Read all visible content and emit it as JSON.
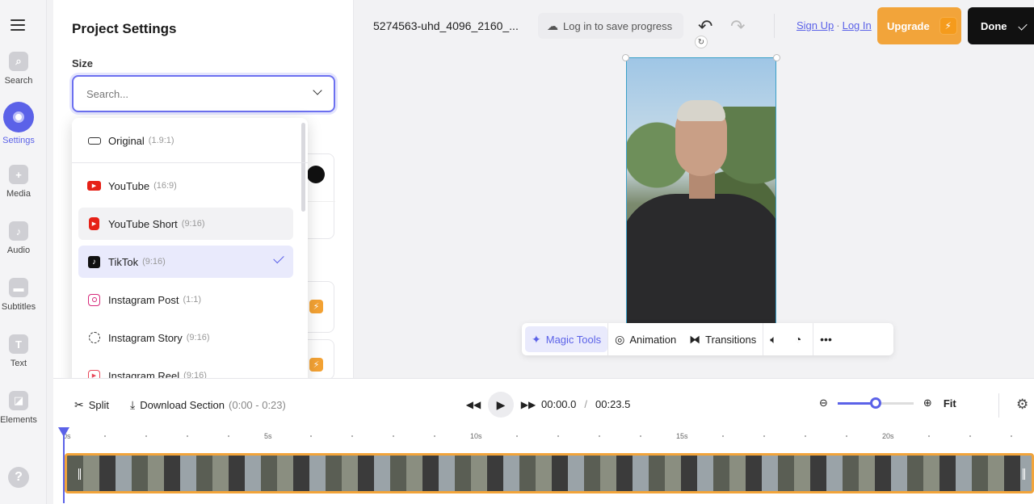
{
  "rail": {
    "items": [
      {
        "label": "Search",
        "icon": "search-icon"
      },
      {
        "label": "Settings",
        "icon": "settings-icon"
      },
      {
        "label": "Media",
        "icon": "plus-icon"
      },
      {
        "label": "Audio",
        "icon": "music-note-icon"
      },
      {
        "label": "Subtitles",
        "icon": "subtitles-icon"
      },
      {
        "label": "Text",
        "icon": "text-icon"
      },
      {
        "label": "Elements",
        "icon": "elements-icon"
      }
    ],
    "help": "?"
  },
  "panel": {
    "title": "Project Settings",
    "size_label": "Size",
    "search_placeholder": "Search..."
  },
  "dropdown": {
    "options": [
      {
        "label": "Original",
        "ratio": "(1.9:1)",
        "icon": "rectangle-icon"
      },
      {
        "label": "YouTube",
        "ratio": "(16:9)",
        "icon": "youtube-icon"
      },
      {
        "label": "YouTube Short",
        "ratio": "(9:16)",
        "icon": "youtube-shorts-icon"
      },
      {
        "label": "TikTok",
        "ratio": "(9:16)",
        "icon": "tiktok-icon",
        "selected": true
      },
      {
        "label": "Instagram Post",
        "ratio": "(1:1)",
        "icon": "instagram-icon"
      },
      {
        "label": "Instagram Story",
        "ratio": "(9:16)",
        "icon": "instagram-story-icon"
      },
      {
        "label": "Instagram Reel",
        "ratio": "(9:16)",
        "icon": "instagram-reel-icon"
      }
    ]
  },
  "topbar": {
    "filename": "5274563-uhd_4096_2160_...",
    "save_label": "Log in to save progress",
    "signup": "Sign Up",
    "separator": "·",
    "login": "Log In",
    "upgrade": "Upgrade",
    "done": "Done"
  },
  "tools": {
    "magic": "Magic Tools",
    "animation": "Animation",
    "transitions": "Transitions"
  },
  "timeline": {
    "split": "Split",
    "download": "Download Section",
    "download_range": "(0:00 - 0:23)",
    "current_time": "00:00.0",
    "slash": "/",
    "total_time": "00:23.5",
    "fit": "Fit",
    "ruler_labels": [
      "0s",
      "5s",
      "10s",
      "15s",
      "20s"
    ],
    "zoom_level": 0.5
  },
  "colors": {
    "accent": "#5b62e8",
    "upgrade": "#f2a43a",
    "done": "#111111"
  }
}
